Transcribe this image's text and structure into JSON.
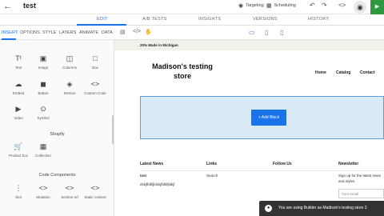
{
  "topbar": {
    "back_icon": "arrow-left-icon",
    "title": "test",
    "targeting_label": "Targeting",
    "scheduling_label": "Scheduling",
    "undo_icon": "undo-icon",
    "redo_icon": "redo-icon",
    "code_icon": "code-icon",
    "preview_icon": "eye-icon",
    "publish_icon": "publish-icon",
    "publish_color": "#2e9a3f"
  },
  "main_tabs": [
    {
      "label": "EDIT",
      "active": true
    },
    {
      "label": "A/B TESTS",
      "active": false
    },
    {
      "label": "INSIGHTS",
      "active": false
    },
    {
      "label": "VERSIONS",
      "active": false
    },
    {
      "label": "HISTORY",
      "active": false
    }
  ],
  "left_panel": {
    "sub_tabs": [
      {
        "label": "INSERT",
        "active": true
      },
      {
        "label": "OPTIONS"
      },
      {
        "label": "STYLE"
      },
      {
        "label": "LAYERS"
      },
      {
        "label": "ANIMATE"
      },
      {
        "label": "DATA"
      }
    ],
    "blocks_row1": [
      {
        "label": "Text",
        "icon": "text-icon"
      },
      {
        "label": "Image",
        "icon": "image-icon"
      },
      {
        "label": "Columns",
        "icon": "columns-icon"
      },
      {
        "label": "Box",
        "icon": "box-icon"
      }
    ],
    "blocks_row2": [
      {
        "label": "Embed",
        "icon": "cloud-upload-icon"
      },
      {
        "label": "Button",
        "icon": "button-icon"
      },
      {
        "label": "Section",
        "icon": "layers-icon"
      },
      {
        "label": "Custom Code",
        "icon": "code-icon"
      }
    ],
    "blocks_row3": [
      {
        "label": "Video",
        "icon": "video-icon"
      },
      {
        "label": "Symbol",
        "icon": "symbol-icon"
      }
    ],
    "shopify_title": "Shopify",
    "shopify_blocks": [
      {
        "label": "Product box",
        "icon": "cart-icon"
      },
      {
        "label": "Collection",
        "icon": "collection-icon"
      }
    ],
    "code_title": "Code Components",
    "code_blocks": [
      {
        "label": "Slot",
        "icon": "slot-icon"
      },
      {
        "label": "Mutation",
        "icon": "mutation-icon"
      },
      {
        "label": "Section ref",
        "icon": "section-ref-icon"
      },
      {
        "label": "Static content",
        "icon": "static-content-icon"
      }
    ]
  },
  "device_toolbar": {
    "desktop": "desktop-icon",
    "tablet": "tablet-icon",
    "mobile": "mobile-icon"
  },
  "preview": {
    "announcement": "20% Made in Michigan",
    "store_name": "Madison's testing store",
    "nav": [
      "Home",
      "Catalog",
      "Contact"
    ],
    "add_block_label": "+ Add Block",
    "footer": {
      "latest_news_title": "Latest News",
      "latest_news_item": "test",
      "latest_news_body": "dskjfldkfjldskjfldkfjldkjf",
      "links_title": "Links",
      "links_item": "Search",
      "follow_title": "Follow Us",
      "newsletter_title": "Newsletter",
      "newsletter_text_1": "Sign up for the latest news",
      "newsletter_text_2": "and styles",
      "email_placeholder": "Your email"
    }
  },
  "toast": {
    "message": "You are using Builder as Madison's testing store 2",
    "icon": "user-icon"
  }
}
